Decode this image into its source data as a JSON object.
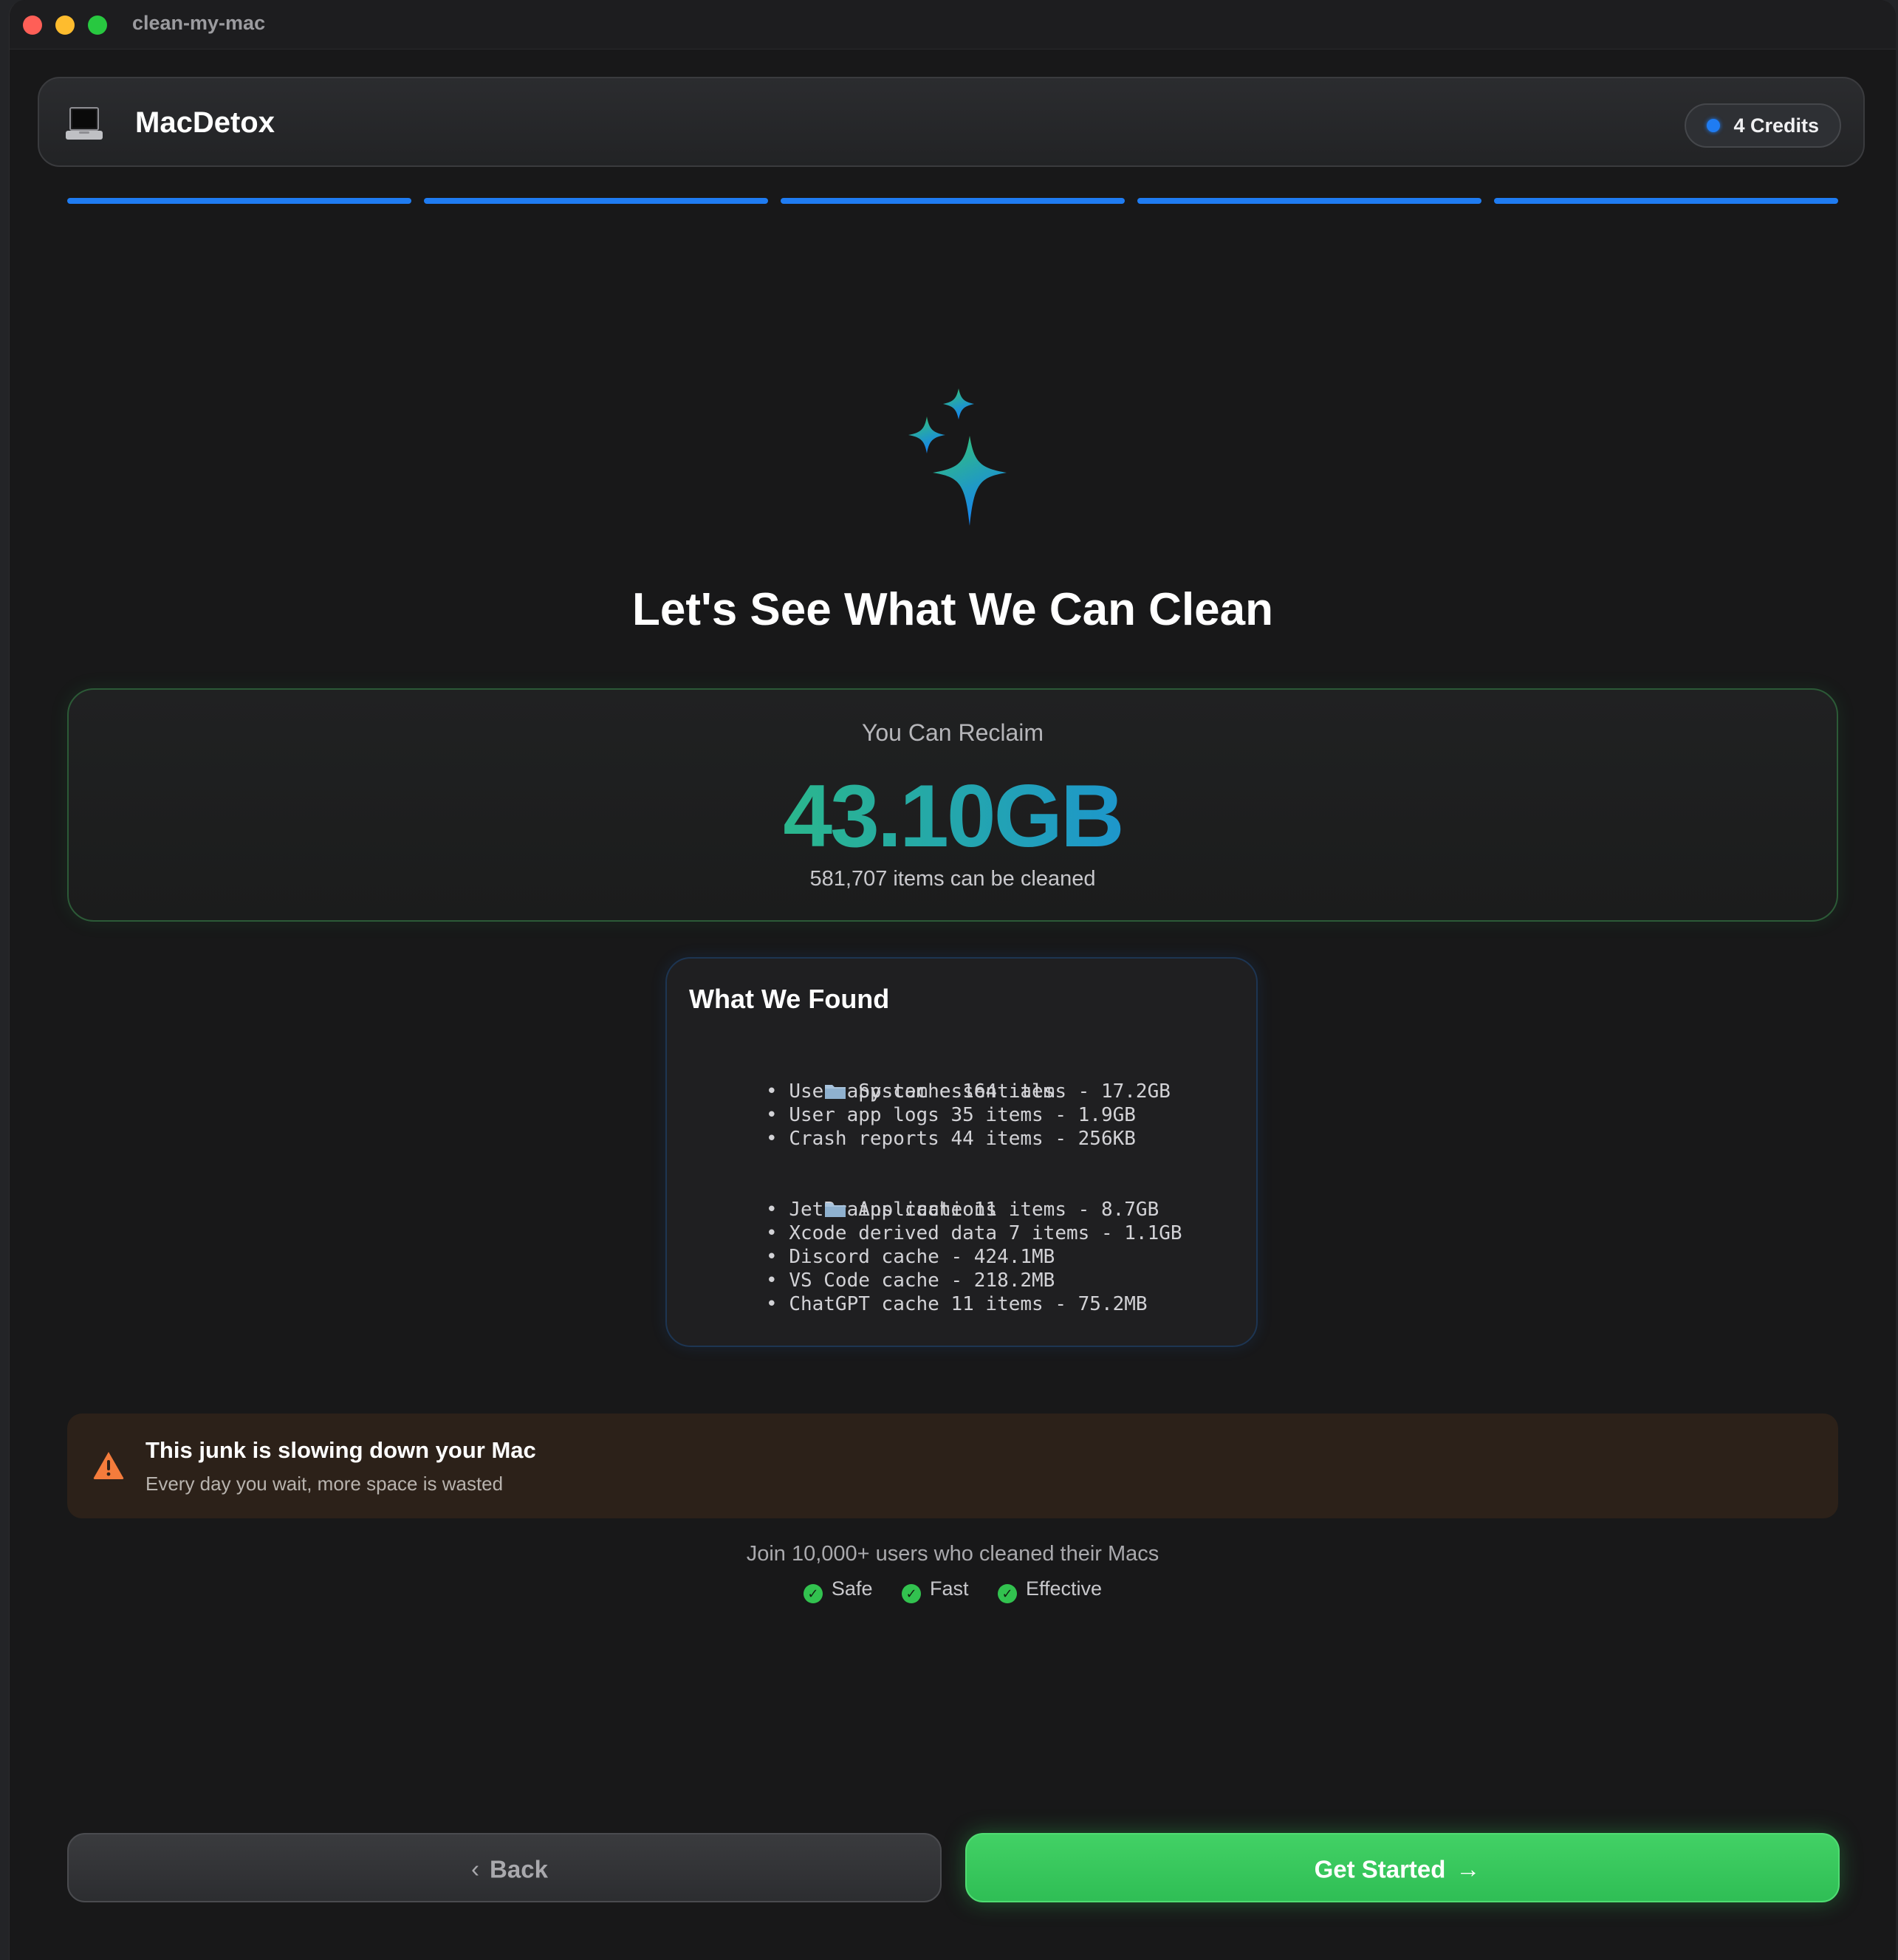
{
  "window": {
    "title": "clean-my-mac"
  },
  "header": {
    "app_name": "MacDetox",
    "credits_label": "4 Credits"
  },
  "progress": {
    "steps_total": 5,
    "steps_completed": 5
  },
  "hero": {
    "headline": "Let's See What We Can Clean"
  },
  "reclaim": {
    "label": "You Can Reclaim",
    "value": "43.10GB",
    "items_text": "581,707 items can be cleaned"
  },
  "found": {
    "title": "What We Found",
    "groups": [
      {
        "name": "System essentials",
        "items": [
          "User app cache 164 items - 17.2GB",
          "User app logs 35 items - 1.9GB",
          "Crash reports 44 items - 256KB"
        ]
      },
      {
        "name": "Applications",
        "items": [
          "JetBrains cache 11 items - 8.7GB",
          "Xcode derived data 7 items - 1.1GB",
          "Discord cache - 424.1MB",
          "VS Code cache - 218.2MB",
          "ChatGPT cache 11 items - 75.2MB"
        ]
      }
    ]
  },
  "warning": {
    "title": "This junk is slowing down your Mac",
    "subtitle": "Every day you wait, more space is wasted"
  },
  "social_proof": {
    "text": "Join 10,000+ users who cleaned their Macs",
    "badges": [
      "Safe",
      "Fast",
      "Effective"
    ]
  },
  "actions": {
    "back_label": "Back",
    "start_label": "Get Started"
  },
  "colors": {
    "accent_blue": "#1f7cf2",
    "accent_green": "#34c759",
    "warning_orange": "#f47c3c"
  },
  "icons": {
    "logo": "laptop-icon",
    "hero": "sparkles-icon",
    "folder": "folder-icon",
    "warning": "warning-triangle-icon",
    "check": "checkmark-circle-icon",
    "back": "chevron-left-icon",
    "forward": "arrow-right-icon"
  }
}
